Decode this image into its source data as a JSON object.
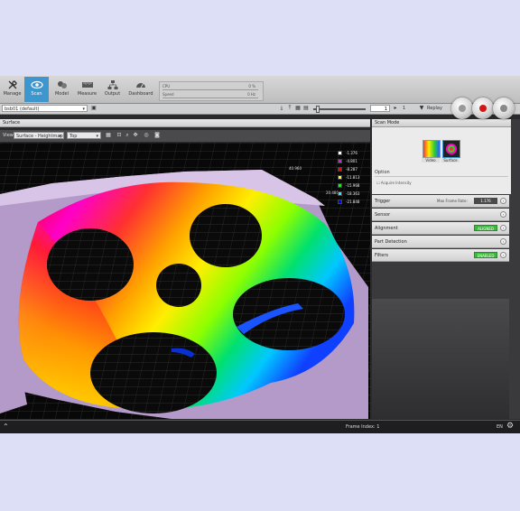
{
  "toolbar": {
    "items": [
      {
        "label": "Manage",
        "icon": "wrench-icon"
      },
      {
        "label": "Scan",
        "icon": "scan-eye-icon"
      },
      {
        "label": "Model",
        "icon": "model-icon"
      },
      {
        "label": "Measure",
        "icon": "measure-icon"
      },
      {
        "label": "Output",
        "icon": "output-icon"
      },
      {
        "label": "Dashboard",
        "icon": "dashboard-icon"
      }
    ],
    "active": "Scan",
    "stats": [
      {
        "label": "CPU",
        "value": "0 %"
      },
      {
        "label": "Speed",
        "value": "0 Hz"
      }
    ]
  },
  "subbar": {
    "job": "bsb01 (default)",
    "frame_index": "1",
    "frame_total": "1",
    "replay_label": "Replay",
    "slider_position": 0.05
  },
  "surface": {
    "title": "Surface",
    "view_label": "View",
    "view_mode": "Surface - Heightmap",
    "orientation": "Top",
    "legend": [
      {
        "label": "-1.376",
        "color": "#ffffff"
      },
      {
        "label": "-4.801",
        "color": "#ff00ff"
      },
      {
        "label": "-8.287",
        "color": "#ff0000"
      },
      {
        "label": "-11.813",
        "color": "#ffff00"
      },
      {
        "label": "-15.968",
        "color": "#00ff00"
      },
      {
        "label": "-18.363",
        "color": "#00ffff"
      },
      {
        "label": "-21.848",
        "color": "#0000ff"
      }
    ],
    "dimensions": [
      "40.960",
      "20.480"
    ]
  },
  "scan_mode": {
    "title": "Scan Mode",
    "modes": [
      "Video",
      "Surface"
    ],
    "option_title": "Option",
    "option_checkbox": "Acquire Intensity"
  },
  "sections": [
    {
      "label": "Trigger",
      "value_label": "Max Frame Rate:",
      "value": "1.176",
      "kind": "value"
    },
    {
      "label": "Sensor",
      "kind": "plain"
    },
    {
      "label": "Alignment",
      "badge": "ALIGNED",
      "kind": "badge"
    },
    {
      "label": "Part Detection",
      "kind": "plain"
    },
    {
      "label": "Filters",
      "badge": "ENABLED",
      "kind": "badge"
    }
  ],
  "status": {
    "frame_index": "Frame Index: 1",
    "lang": "EN"
  },
  "colors": {
    "accent": "#3e96cf",
    "badge_green": "#3cb93c",
    "background_outer": "#dcdff5"
  }
}
